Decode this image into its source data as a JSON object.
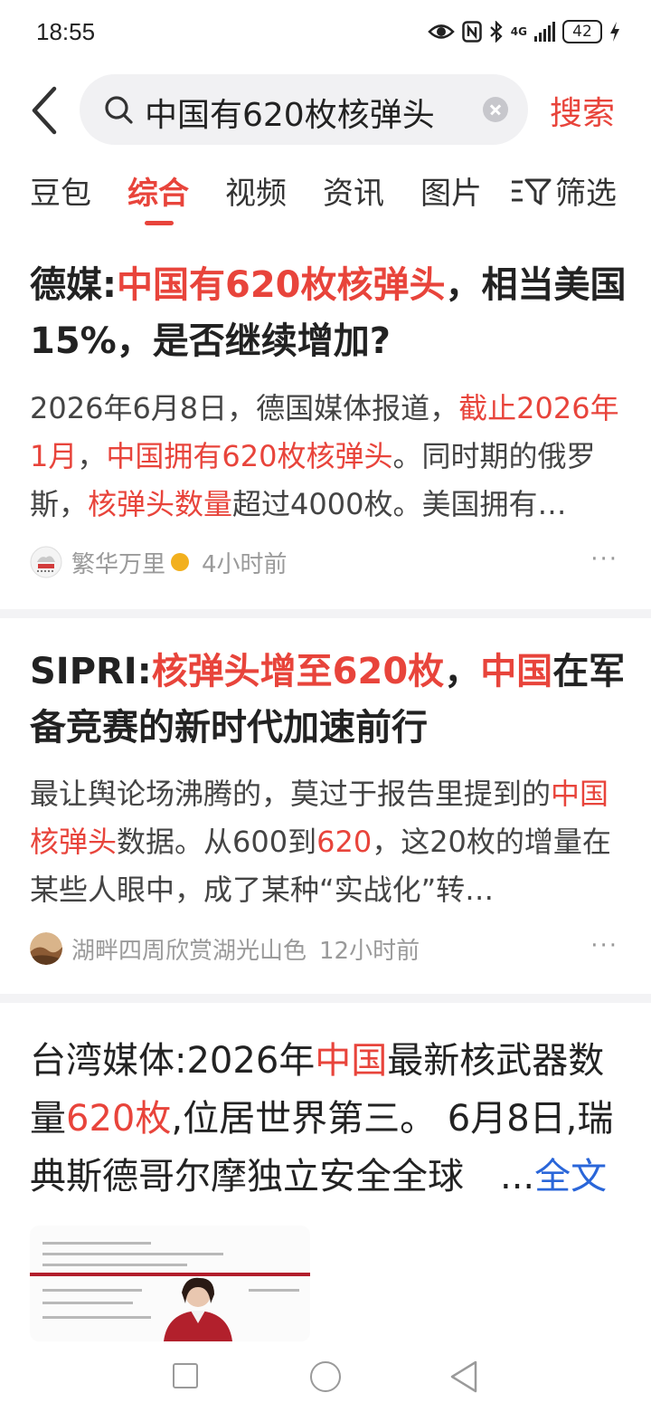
{
  "status_bar": {
    "time": "18:55",
    "network": "4G",
    "battery": "42",
    "icons": [
      "eye-icon",
      "nfc-icon",
      "bluetooth-icon",
      "signal-icon",
      "battery-icon",
      "charging-icon"
    ]
  },
  "search": {
    "query": "中国有620枚核弹头",
    "button_label": "搜索"
  },
  "tabs": [
    {
      "label": "豆包",
      "active": false
    },
    {
      "label": "综合",
      "active": true
    },
    {
      "label": "视频",
      "active": false
    },
    {
      "label": "资讯",
      "active": false
    },
    {
      "label": "图片",
      "active": false
    }
  ],
  "filter_label": "筛选",
  "articles": [
    {
      "title": {
        "a": "德媒:",
        "b": "中国有620枚核弹头",
        "c": "，相当美国15%，是否继续增加?"
      },
      "snippet": {
        "a": "2026年6月8日，德国媒体报道，",
        "b": "截止2026年1月",
        "c": "，",
        "d": "中国拥有620枚核弹头",
        "e": "。同时期的俄罗斯，",
        "f": "核弹头数量",
        "g": "超过4000枚。美国拥有…"
      },
      "author": "繁华万里",
      "time": "4小时前",
      "more": "···"
    },
    {
      "title": {
        "a": "SIPRI:",
        "b": "核弹头增至620枚",
        "c": "，",
        "d": "中国",
        "e": "在军备竞赛的新时代加速前行"
      },
      "snippet": {
        "a": "最让舆论场沸腾的，莫过于报告里提到的",
        "b": "中国核弹头",
        "c": "数据。从600到",
        "d": "620",
        "e": "，这20枚的增量在某些人眼中，成了某种“实战化”转…"
      },
      "author": "湖畔四周欣赏湖光山色",
      "time": "12小时前",
      "more": "···"
    },
    {
      "title": {
        "a": "台湾媒体:2026年",
        "b": "中国",
        "c": "最新核武器数量",
        "d": "620枚",
        "e": ",位居世界第三。 6月8日,瑞典斯德哥尔摩独立安全全球　...",
        "f": "全文"
      }
    }
  ],
  "colors": {
    "accent": "#e8443b",
    "link": "#2a66d9",
    "meta": "#9a9a9a"
  }
}
